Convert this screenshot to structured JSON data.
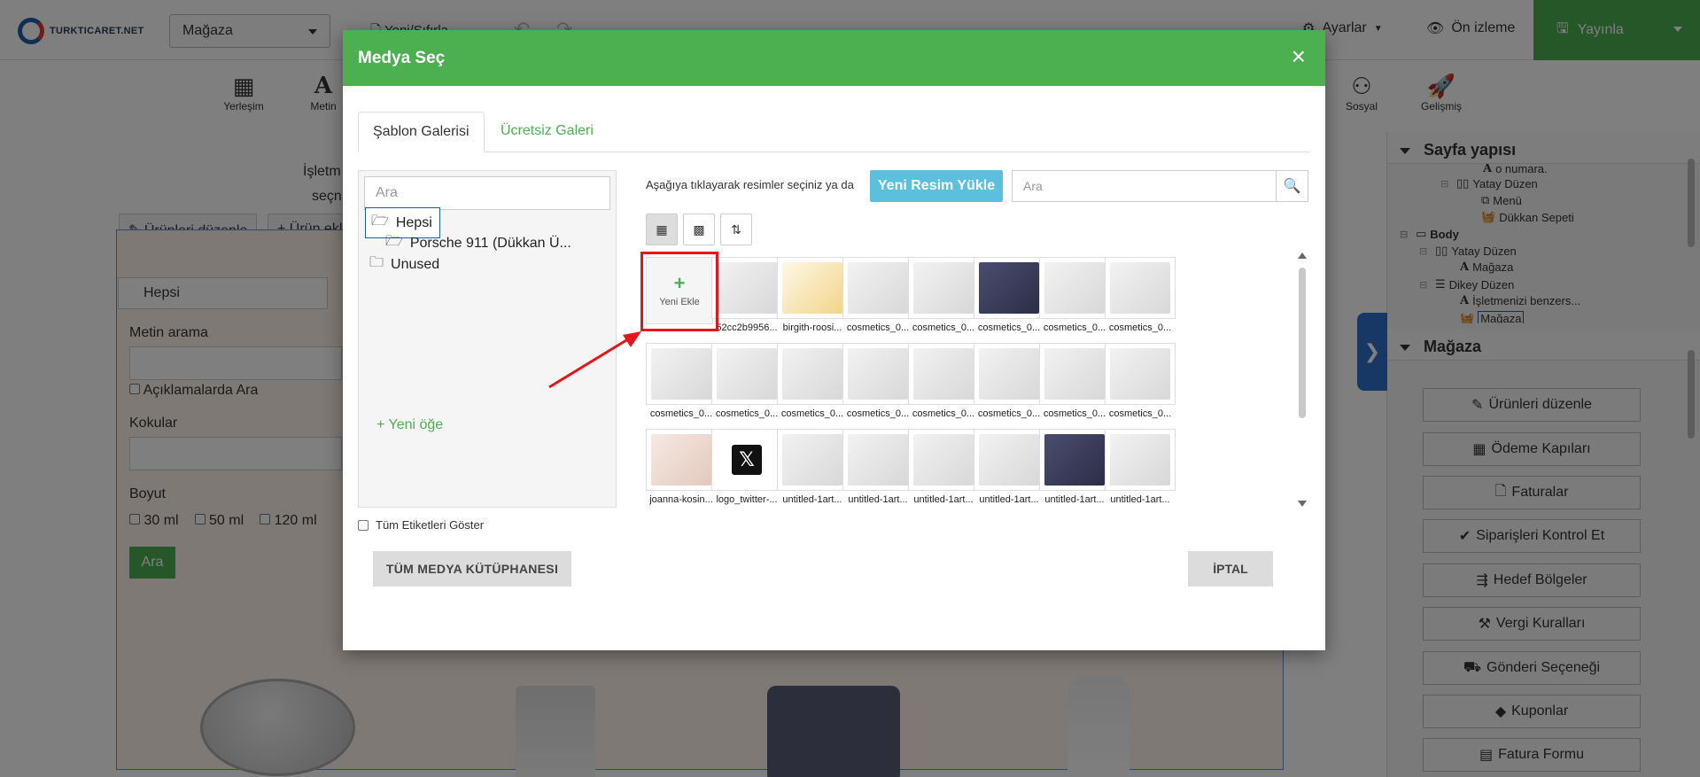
{
  "app": {
    "logo_text": "TURKTICARET.NET",
    "store_select": "Mağaza",
    "new_reset": "Yeni/Sıfırla",
    "settings": "Ayarlar",
    "preview": "Ön izleme",
    "publish": "Yayınla"
  },
  "tools": [
    {
      "label": "Yerleşim",
      "icon": "layout-icon"
    },
    {
      "label": "Metin",
      "icon": "text-icon"
    },
    {
      "label": "Sosyal",
      "icon": "social-icon"
    },
    {
      "label": "Gelişmiş",
      "icon": "rocket-icon"
    }
  ],
  "canvas": {
    "business_text_1": "İşletm",
    "business_text_2": "seçn",
    "edit_products": "Ürünleri düzenle",
    "add_product": "Ürün ekl",
    "category_select": "Hepsi",
    "text_search_label": "Metin arama",
    "search_in_desc": "Açıklamalarda Ara",
    "scents_label": "Kokular",
    "size_label": "Boyut",
    "size_options": [
      "30 ml",
      "50 ml",
      "120 ml"
    ],
    "search_button": "Ara"
  },
  "right_panel": {
    "page_structure_title": "Sayfa yapısı",
    "tree": [
      {
        "label": "o numara.",
        "type": "text"
      },
      {
        "label": "Yatay Düzen",
        "type": "hlayout"
      },
      {
        "label": "Menü",
        "type": "menu"
      },
      {
        "label": "Dükkan Sepeti",
        "type": "cart"
      },
      {
        "label": "Body",
        "type": "body"
      },
      {
        "label": "Yatay Düzen",
        "type": "hlayout"
      },
      {
        "label": "Mağaza",
        "type": "text"
      },
      {
        "label": "Dikey Düzen",
        "type": "vlayout"
      },
      {
        "label": "İşletmenizi benzers...",
        "type": "text"
      },
      {
        "label": "Mağaza",
        "type": "store"
      }
    ],
    "store_title": "Mağaza",
    "buttons": [
      {
        "label": "Ürünleri düzenle",
        "icon": "pencil-icon"
      },
      {
        "label": "Ödeme Kapıları",
        "icon": "grid-icon"
      },
      {
        "label": "Faturalar",
        "icon": "file-icon"
      },
      {
        "label": "Siparişleri Kontrol Et",
        "icon": "check-icon"
      },
      {
        "label": "Hedef Bölgeler",
        "icon": "signpost-icon"
      },
      {
        "label": "Vergi Kuralları",
        "icon": "gavel-icon"
      },
      {
        "label": "Gönderi Seçeneği",
        "icon": "truck-icon"
      },
      {
        "label": "Kuponlar",
        "icon": "tag-icon"
      },
      {
        "label": "Fatura Formu",
        "icon": "form-icon"
      }
    ]
  },
  "modal": {
    "title": "Medya Seç",
    "tabs": [
      "Şablon Galerisi",
      "Ücretsiz Galeri"
    ],
    "left_search_placeholder": "Ara",
    "folders": [
      {
        "label": "Hepsi",
        "selected": true
      },
      {
        "label": "Porsche 911 (Dükkan Ü...",
        "selected": false
      },
      {
        "label": "Unused",
        "selected": false
      }
    ],
    "new_item": "Yeni öğe",
    "show_all_tags": "Tüm Etiketleri Göster",
    "instruction": "Aşağıya tıklayarak resimler seçiniz ya da",
    "upload_button": "Yeni Resim Yükle",
    "search_placeholder": "Ara",
    "add_new": "Yeni Ekle",
    "media": [
      {
        "name": "52cc2b9956...",
        "tone": "light"
      },
      {
        "name": "birgith-roosi...",
        "tone": "warm"
      },
      {
        "name": "cosmetics_0...",
        "tone": "light"
      },
      {
        "name": "cosmetics_0...",
        "tone": "light"
      },
      {
        "name": "cosmetics_0...",
        "tone": "dark"
      },
      {
        "name": "cosmetics_0...",
        "tone": "light"
      },
      {
        "name": "cosmetics_0...",
        "tone": "light"
      },
      {
        "name": "cosmetics_0...",
        "tone": "light"
      },
      {
        "name": "cosmetics_0...",
        "tone": "light"
      },
      {
        "name": "cosmetics_0...",
        "tone": "light"
      },
      {
        "name": "cosmetics_0...",
        "tone": "light"
      },
      {
        "name": "cosmetics_0...",
        "tone": "light"
      },
      {
        "name": "cosmetics_0...",
        "tone": "light"
      },
      {
        "name": "cosmetics_0...",
        "tone": "light"
      },
      {
        "name": "cosmetics_0...",
        "tone": "light"
      },
      {
        "name": "joanna-kosin...",
        "tone": "pink"
      },
      {
        "name": "logo_twitter-...",
        "tone": "x"
      },
      {
        "name": "untitled-1art...",
        "tone": "light"
      },
      {
        "name": "untitled-1art...",
        "tone": "light"
      },
      {
        "name": "untitled-1art...",
        "tone": "light"
      },
      {
        "name": "untitled-1art...",
        "tone": "light"
      },
      {
        "name": "untitled-1art...",
        "tone": "dark"
      },
      {
        "name": "untitled-1art...",
        "tone": "light"
      }
    ],
    "library_button": "TÜM MEDYA KÜTÜPHANESI",
    "cancel_button": "İPTAL"
  },
  "colors": {
    "brand_green": "#4caf50",
    "info_blue": "#5bc0de",
    "highlight_red": "#e8141a"
  }
}
